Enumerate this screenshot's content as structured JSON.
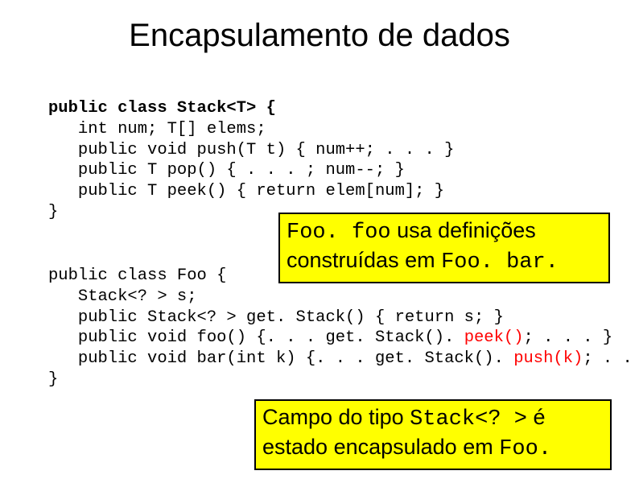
{
  "title": "Encapsulamento de dados",
  "code1": {
    "l1a": "public class Stack<T> {",
    "l2": "   int num; T[] elems;",
    "l3": "   public void push(T t) { num++; . . . }",
    "l4": "   public T pop() { . . . ; num--; }",
    "l5": "   public T peek() { return elem[num]; }",
    "l6": "}"
  },
  "box1": {
    "mono1": "Foo. foo",
    "t1": " usa definições",
    "t2": "construídas em ",
    "mono2": "Foo. bar",
    "t3": "."
  },
  "code2": {
    "l1": "public class Foo {",
    "l2": "   Stack<? > s;",
    "l3": "   public Stack<? > get. Stack() { return s; }",
    "l4a": "   public void foo() {. . . get. Stack(). ",
    "l4red": "peek()",
    "l4b": "; . . . }",
    "l5a": "   public void bar(int k) {. . . get. Stack(). ",
    "l5red": "push(k)",
    "l5b": "; . . . }",
    "l6": "}"
  },
  "box2": {
    "t1": "Campo do tipo ",
    "mono1": "Stack<? >",
    "t2": " é",
    "t3": "estado encapsulado em ",
    "mono2": "Foo",
    "t4": "."
  }
}
